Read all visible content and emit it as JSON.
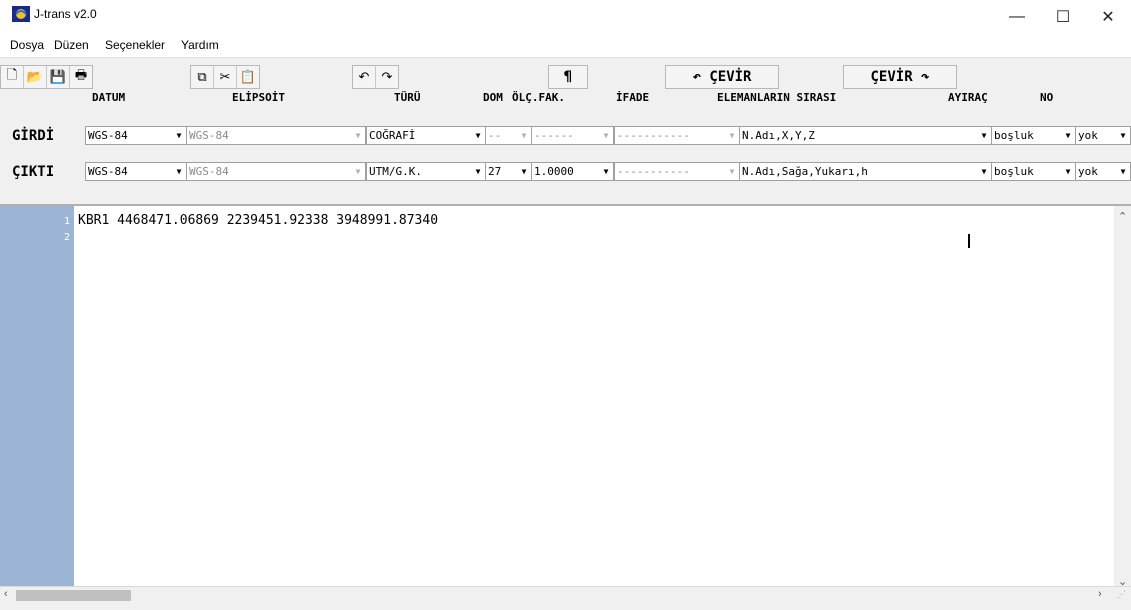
{
  "window": {
    "title": "J-trans v2.0",
    "minimize": "—",
    "maximize": "☐",
    "close": "✕"
  },
  "menu": [
    "Dosya",
    "Düzen",
    "Seçenekler",
    "Yardım"
  ],
  "toolbar": {
    "file_icons": [
      "🗋",
      "📂",
      "💾",
      "🖶"
    ],
    "clip_icons": [
      "⧉",
      "✂",
      "📋"
    ],
    "undo_icons": [
      "↶",
      "↷"
    ],
    "paragraph": "¶",
    "cevir_back": "↶ ÇEVİR",
    "cevir_fwd": "ÇEVİR ↷"
  },
  "columns": {
    "datum": "DATUM",
    "elipsoit": "ELİPSOİT",
    "turu": "TÜRÜ",
    "dom": "DOM",
    "olcfak": "ÖLÇ.FAK.",
    "ifade": "İFADE",
    "elemanlar": "ELEMANLARIN SIRASI",
    "ayirac": "AYIRAÇ",
    "no": "NO"
  },
  "girdi": {
    "label": "GİRDİ",
    "datum": "WGS-84",
    "elipsoit": "WGS-84",
    "turu": "COĞRAFİ",
    "dom": "--",
    "olcfak": "------",
    "ifade": "-----------",
    "elemanlar": "N.Adı,X,Y,Z",
    "ayirac": "boşluk",
    "no": "yok"
  },
  "cikti": {
    "label": "ÇIKTI",
    "datum": "WGS-84",
    "elipsoit": "WGS-84",
    "turu": "UTM/G.K.",
    "dom": "27",
    "olcfak": "1.0000",
    "ifade": "-----------",
    "elemanlar": "N.Adı,Sağa,Yukarı,h",
    "ayirac": "boşluk",
    "no": "yok"
  },
  "editor": {
    "line_numbers": [
      "1",
      "2"
    ],
    "lines": [
      "KBR1 4468471.06869 2239451.92338 3948991.87340",
      ""
    ]
  },
  "colors": {
    "gutter": "#9db5d4"
  }
}
